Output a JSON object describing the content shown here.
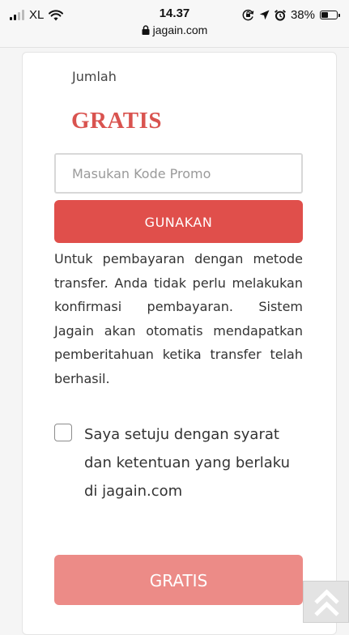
{
  "status_bar": {
    "carrier": "XL",
    "time": "14.37",
    "battery": "38%",
    "url": "jagain.com",
    "icons": [
      "signal-icon",
      "wifi-icon",
      "lock-icon",
      "rotation-lock-icon",
      "location-icon",
      "alarm-icon",
      "battery-icon"
    ]
  },
  "order": {
    "total_label": "Jumlah",
    "total_value": "GRATIS"
  },
  "promo": {
    "placeholder": "Masukan Kode Promo",
    "value": "",
    "apply_label": "GUNAKAN"
  },
  "info_text": "Untuk pembayaran dengan metode transfer. Anda tidak perlu melakukan konfirmasi pembayaran. Sistem Jagain akan otomatis mendapatkan pemberitahuan ketika transfer telah berhasil.",
  "agreement": {
    "checked": false,
    "label": "Saya setuju dengan syarat dan ketentuan yang berlaku di jagain.com"
  },
  "submit_label": "GRATIS",
  "colors": {
    "accent": "#e04f4b",
    "accent_disabled": "#ec8b87",
    "title": "#d9534f"
  },
  "scroll_top_icon": "double-chevron-up-icon"
}
